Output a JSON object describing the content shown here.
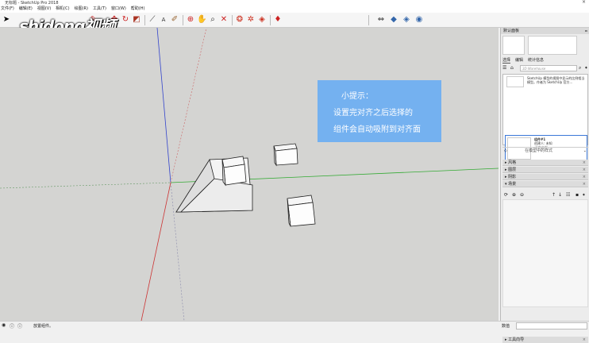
{
  "window": {
    "title": "无标题 - SketchUp Pro 2018",
    "close_glyph": "×"
  },
  "watermark": "shidong视频",
  "menu": [
    "文件(F)",
    "编辑(E)",
    "视图(V)",
    "相机(C)",
    "绘图(R)",
    "工具(T)",
    "窗口(W)",
    "帮助(H)"
  ],
  "toolbar": {
    "icons": [
      "select-icon",
      "eraser-icon",
      "paint-bucket-icon",
      "move-icon",
      "rotate-icon",
      "scale-icon",
      "tape-measure-icon",
      "text-icon",
      "paint-icon",
      "orbit-icon",
      "pan-icon",
      "zoom-icon",
      "zoom-extents-icon",
      "warehouse-icon",
      "extension-icon",
      "component-icon",
      "ruby-icon",
      "axes-icon",
      "standard-view-icon",
      "top-view-icon",
      "iso-view-icon"
    ]
  },
  "tip": {
    "title": "小提示：",
    "line1": "设置完对齐之后选择的",
    "line2": "组件会自动吸附到对齐面"
  },
  "status": {
    "text": "放置组件。",
    "measure_label": "数值"
  },
  "tray": {
    "header": "默认面板",
    "pin_glyph": "ⴰ",
    "tabs": [
      "选择",
      "编辑",
      "统计信息"
    ],
    "search_placeholder": "3D Warehouse",
    "components": [
      {
        "line1": "SketchUp 模型的视图中显示的比例相当",
        "line2": "模型。作者为 SketchUp 官方..."
      },
      {
        "line1": "组件#1",
        "line2": "创建人: 未知",
        "line3": "没有说明"
      }
    ],
    "nested_label": "在模型中的样式",
    "panels": [
      "风格",
      "图层",
      "阴影",
      "场景"
    ],
    "instructor": "工具向导",
    "panel_close": "×"
  },
  "colors": {
    "viewport_bg": "#d4d4d2",
    "tip_bg": "#74b1f0",
    "axis_red": "#cc3333",
    "axis_green": "#33aa33",
    "axis_blue": "#3333cc"
  }
}
